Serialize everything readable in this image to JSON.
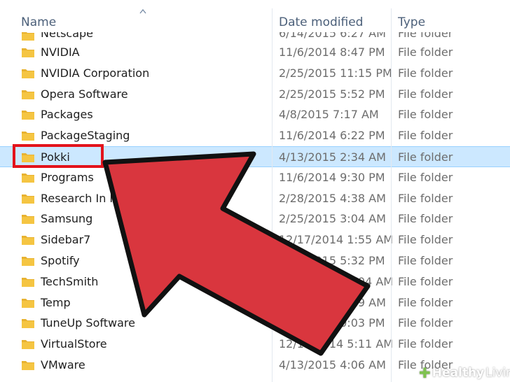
{
  "columns": {
    "name": "Name",
    "date_modified": "Date modified",
    "type": "Type"
  },
  "partial_row": {
    "name": "Netscape",
    "date": "6/14/2015 6:27 AM",
    "type": "File folder"
  },
  "rows": [
    {
      "name": "NVIDIA",
      "date": "11/6/2014 8:47 PM",
      "type": "File folder"
    },
    {
      "name": "NVIDIA Corporation",
      "date": "2/25/2015 11:15 PM",
      "type": "File folder"
    },
    {
      "name": "Opera Software",
      "date": "2/25/2015 5:52 PM",
      "type": "File folder"
    },
    {
      "name": "Packages",
      "date": "4/8/2015 7:17 AM",
      "type": "File folder"
    },
    {
      "name": "PackageStaging",
      "date": "11/6/2014 6:22 PM",
      "type": "File folder"
    },
    {
      "name": "Pokki",
      "date": "4/13/2015 2:34 AM",
      "type": "File folder"
    },
    {
      "name": "Programs",
      "date": "11/6/2014 9:30 PM",
      "type": "File folder"
    },
    {
      "name": "Research In Motion",
      "date": "2/28/2015 4:38 AM",
      "type": "File folder"
    },
    {
      "name": "Samsung",
      "date": "2/25/2015 3:04 AM",
      "type": "File folder"
    },
    {
      "name": "Sidebar7",
      "date": "12/17/2014 1:55 AM",
      "type": "File folder"
    },
    {
      "name": "Spotify",
      "date": "4/14/2015 5:32 PM",
      "type": "File folder"
    },
    {
      "name": "TechSmith",
      "date": "11/10/2014 3:04 AM",
      "type": "File folder"
    },
    {
      "name": "Temp",
      "date": "4/13/2015 4:39 AM",
      "type": "File folder"
    },
    {
      "name": "TuneUp Software",
      "date": "4/8/2015 10:03 PM",
      "type": "File folder"
    },
    {
      "name": "VirtualStore",
      "date": "12/16/2014 5:11 AM",
      "type": "File folder"
    },
    {
      "name": "VMware",
      "date": "4/13/2015 4:06 AM",
      "type": "File folder"
    }
  ],
  "selected_row": "Pokki",
  "colors": {
    "folder": "#f5c542",
    "selection": "#cce8ff",
    "highlight": "#e3131b",
    "arrow_fill": "#d9363e",
    "arrow_stroke": "#1a1a1a"
  },
  "watermark": {
    "brand_bold": "Healthy",
    "brand_light": "Living"
  }
}
